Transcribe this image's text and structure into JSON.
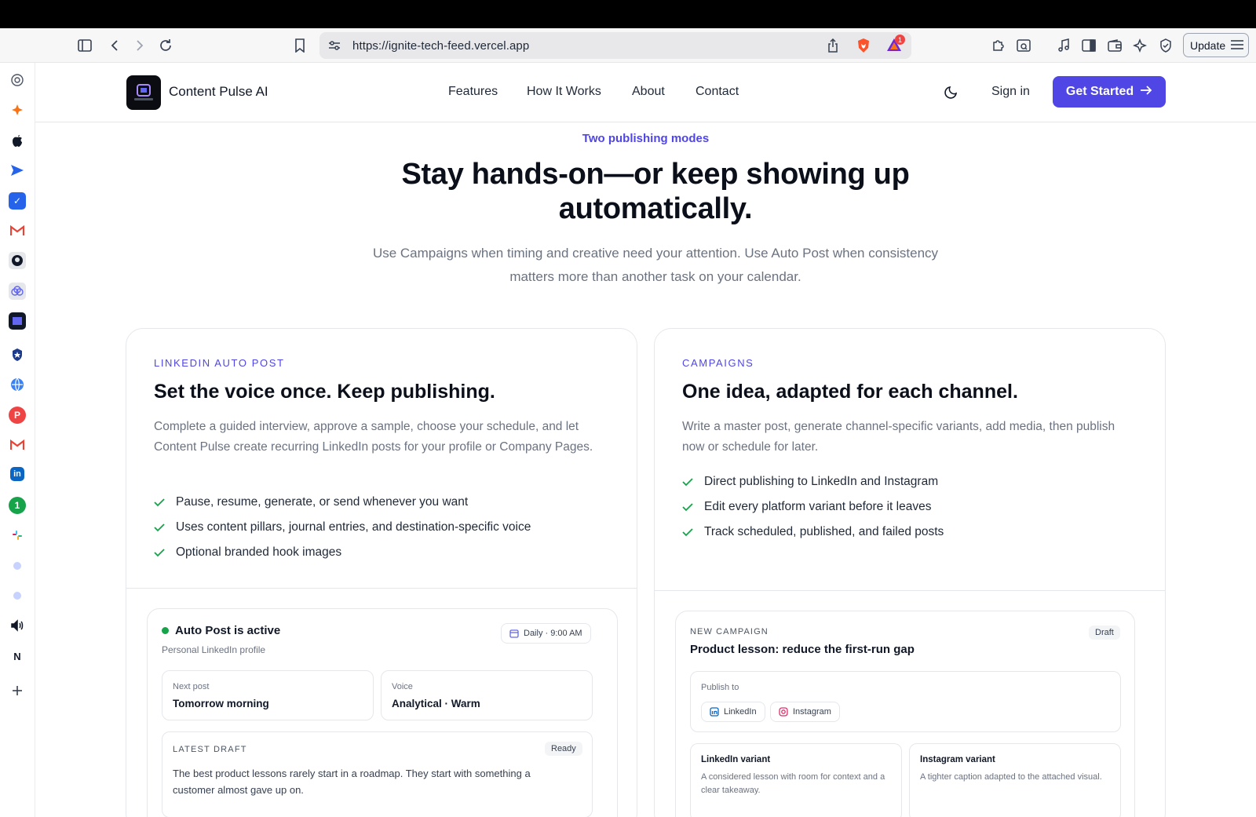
{
  "browser": {
    "url": "https://ignite-tech-feed.vercel.app",
    "update_label": "Update",
    "notification_count": "1"
  },
  "nav": {
    "brand": "Content Pulse AI",
    "links": [
      "Features",
      "How It Works",
      "About",
      "Contact"
    ],
    "sign_in": "Sign in",
    "cta": "Get Started"
  },
  "hero": {
    "eyebrow": "Two publishing modes",
    "title": "Stay hands-on—or keep showing up automatically.",
    "lead": "Use Campaigns when timing and creative need your attention. Use Auto Post when consistency matters more than another task on your calendar."
  },
  "auto_post": {
    "kicker": "LINKEDIN AUTO POST",
    "title": "Set the voice once. Keep publishing.",
    "description": "Complete a guided interview, approve a sample, choose your schedule, and let Content Pulse create recurring LinkedIn posts for your profile or Company Pages.",
    "features": [
      "Pause, resume, generate, or send whenever you want",
      "Uses content pillars, journal entries, and destination-specific voice",
      "Optional branded hook images"
    ],
    "panel": {
      "status": "Auto Post is active",
      "profile": "Personal LinkedIn profile",
      "schedule": "Daily · 9:00 AM",
      "next_post_label": "Next post",
      "next_post_value": "Tomorrow morning",
      "voice_label": "Voice",
      "voice_value": "Analytical · Warm",
      "latest_draft_label": "LATEST DRAFT",
      "latest_draft_status": "Ready",
      "latest_draft_text": "The best product lessons rarely start in a roadmap. They start with something a customer almost gave up on."
    }
  },
  "campaigns": {
    "kicker": "CAMPAIGNS",
    "title": "One idea, adapted for each channel.",
    "description": "Write a master post, generate channel-specific variants, add media, then publish now or schedule for later.",
    "features": [
      "Direct publishing to LinkedIn and Instagram",
      "Edit every platform variant before it leaves",
      "Track scheduled, published, and failed posts"
    ],
    "panel": {
      "label": "NEW CAMPAIGN",
      "status": "Draft",
      "title": "Product lesson: reduce the first-run gap",
      "publish_to": "Publish to",
      "channels": [
        "LinkedIn",
        "Instagram"
      ],
      "linkedin_variant_title": "LinkedIn variant",
      "linkedin_variant_text": "A considered lesson with room for context and a clear takeaway.",
      "instagram_variant_title": "Instagram variant",
      "instagram_variant_text": "A tighter caption adapted to the attached visual."
    }
  },
  "colors": {
    "accent": "#4f46e5",
    "success": "#16a34a",
    "muted": "#6b7280"
  }
}
